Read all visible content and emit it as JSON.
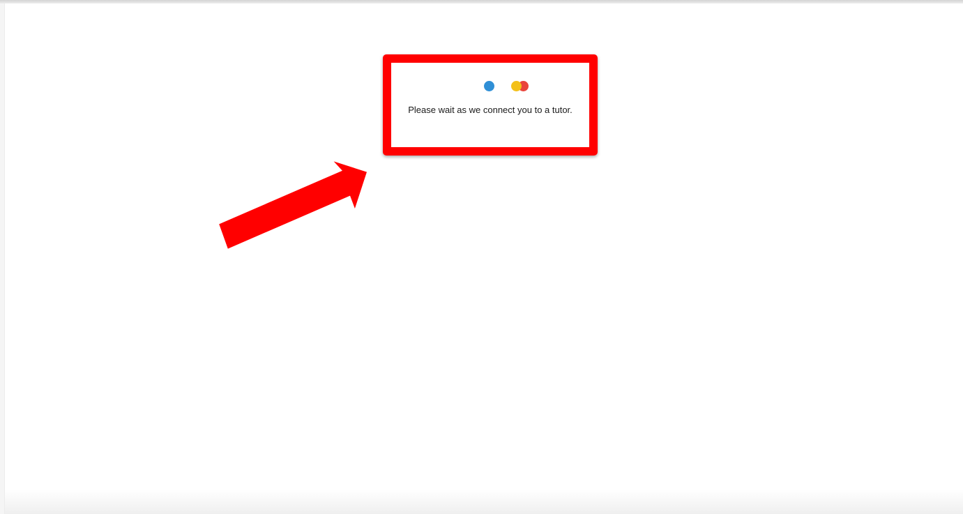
{
  "status": {
    "message": "Please wait as we connect you to a tutor."
  },
  "loader": {
    "dot_colors": [
      "#2f8fd6",
      "#f3c019",
      "#e9443b"
    ]
  },
  "annotation": {
    "color": "#ff0000"
  }
}
